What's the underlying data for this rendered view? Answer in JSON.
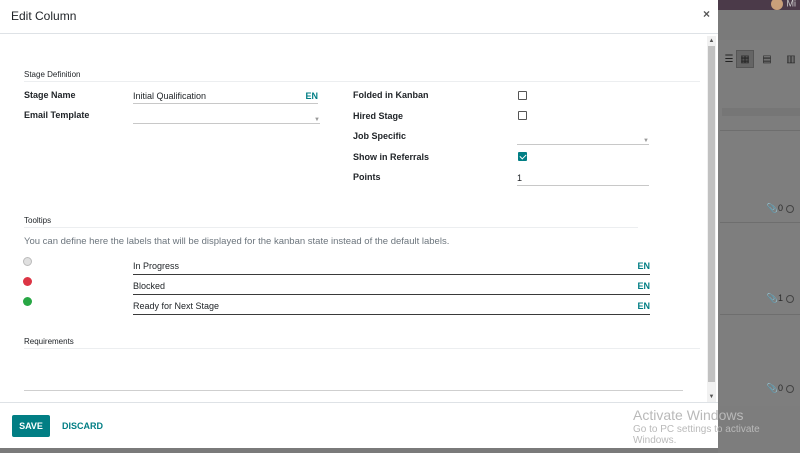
{
  "modal": {
    "title": "Edit Column",
    "close_glyph": "×"
  },
  "stage_definition": {
    "section_title": "Stage Definition",
    "stage_name": {
      "label": "Stage Name",
      "value": "Initial Qualification",
      "lang": "EN"
    },
    "email_template": {
      "label": "Email Template",
      "value": ""
    },
    "folded_in_kanban": {
      "label": "Folded in Kanban",
      "checked": false
    },
    "hired_stage": {
      "label": "Hired Stage",
      "checked": false
    },
    "job_specific": {
      "label": "Job Specific",
      "value": ""
    },
    "show_in_referrals": {
      "label": "Show in Referrals",
      "checked": true
    },
    "points": {
      "label": "Points",
      "value": "1"
    }
  },
  "tooltips": {
    "section_title": "Tooltips",
    "help_text": "You can define here the labels that will be displayed for the kanban state instead of the default labels.",
    "states": [
      {
        "color": "#e0e0e0",
        "label": "In Progress",
        "lang": "EN"
      },
      {
        "color": "#dc3545",
        "label": "Blocked",
        "lang": "EN"
      },
      {
        "color": "#28a745",
        "label": "Ready for Next Stage",
        "lang": "EN"
      }
    ]
  },
  "requirements": {
    "section_title": "Requirements",
    "value": ""
  },
  "footer": {
    "save_label": "SAVE",
    "discard_label": "DISCARD"
  },
  "background": {
    "user_label": "Mi",
    "card_counts": [
      "0",
      "1",
      "0"
    ]
  },
  "watermark": {
    "title": "Activate Windows",
    "subtitle": "Go to PC settings to activate Windows."
  },
  "colors": {
    "primary": "#017e84",
    "red": "#dc3545",
    "green": "#28a745"
  }
}
